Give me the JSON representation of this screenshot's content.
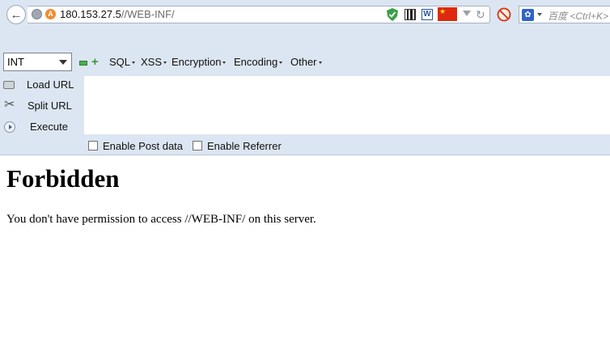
{
  "address_bar": {
    "host": "180.153.27.5",
    "path": "//WEB-INF/"
  },
  "search_box": {
    "placeholder": "百度 <Ctrl+K>"
  },
  "hackbar": {
    "type_select_value": "INT",
    "menus": [
      "SQL",
      "XSS",
      "Encryption",
      "Encoding",
      "Other"
    ],
    "actions": {
      "load": "Load URL",
      "split": "Split URL",
      "execute": "Execute"
    },
    "checkboxes": {
      "post": "Enable Post data",
      "referrer": "Enable Referrer"
    }
  },
  "page": {
    "title": "Forbidden",
    "message": "You don't have permission to access //WEB-INF/ on this server."
  },
  "icons": {
    "back": "back-arrow-icon",
    "globe": "globe-icon",
    "site": "site-identity-icon",
    "shield": "shield-icon",
    "qr": "qr-code-icon",
    "word": "word-icon",
    "flag": "china-flag-icon",
    "reload": "reload-icon",
    "block": "no-script-icon",
    "search_engine": "baidu-paw-icon"
  },
  "colors": {
    "toolbar_bg": "#dce6f2",
    "shield_green": "#3aa14a",
    "flag_red": "#de2910",
    "site_icon_orange": "#f28a2e"
  }
}
